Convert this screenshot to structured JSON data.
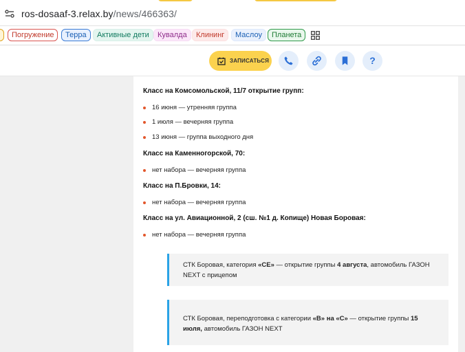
{
  "browser": {
    "url_host": "ros-dosaaf-3.relax.by",
    "url_path": "/news/466363/"
  },
  "bookmarks": [
    "Погружение",
    "Терра",
    "Активные дети",
    "Кувалда",
    "Клининг",
    "Маслоу",
    "Планета"
  ],
  "sitebar": {
    "signup_label": "ЗАПИСАТЬСЯ",
    "help_glyph": "?"
  },
  "article": {
    "sections": [
      {
        "heading": "Класс на Комсомольской, 11/7 открытие групп:",
        "items": [
          "16 июня — утренняя группа",
          "1 июля — вечерняя группа",
          "13 июня — группа выходного дня"
        ]
      },
      {
        "heading": "Класс на Каменногорской, 70:",
        "items": [
          "нет набора — вечерняя группа"
        ]
      },
      {
        "heading": "Класс на П.Бровки, 14:",
        "items": [
          "нет набора — вечерняя группа"
        ]
      },
      {
        "heading": "Класс на ул. Авиационной, 2 (сш. №1 д. Копище) Новая Боровая:",
        "items": [
          "нет набора — вечерняя группа"
        ]
      }
    ],
    "quote1": {
      "t1": "СТК Боровая, категория ",
      "b1": "«СЕ»",
      "t2": " — открытие группы ",
      "b2": "4 августа",
      "t3": ", автомобиль ГАЗОН NEXT с прицепом"
    },
    "quote2": {
      "t1": "СТК Боровая, переподготовка с категории ",
      "b1": "«В» на «С»",
      "t2": " — открытие группы ",
      "b2": "15 июля,",
      "t3": " автомобиль ГАЗОН NEXT"
    }
  },
  "colors": {
    "accent_yellow": "#fbd24e",
    "accent_blue": "#2b6fd6",
    "bullet": "#e2562b",
    "quote_border": "#2aa3e6"
  },
  "icons": [
    "site-info-icon",
    "apps-grid-icon",
    "calendar-check-icon",
    "phone-icon",
    "link-icon",
    "bookmark-icon"
  ]
}
